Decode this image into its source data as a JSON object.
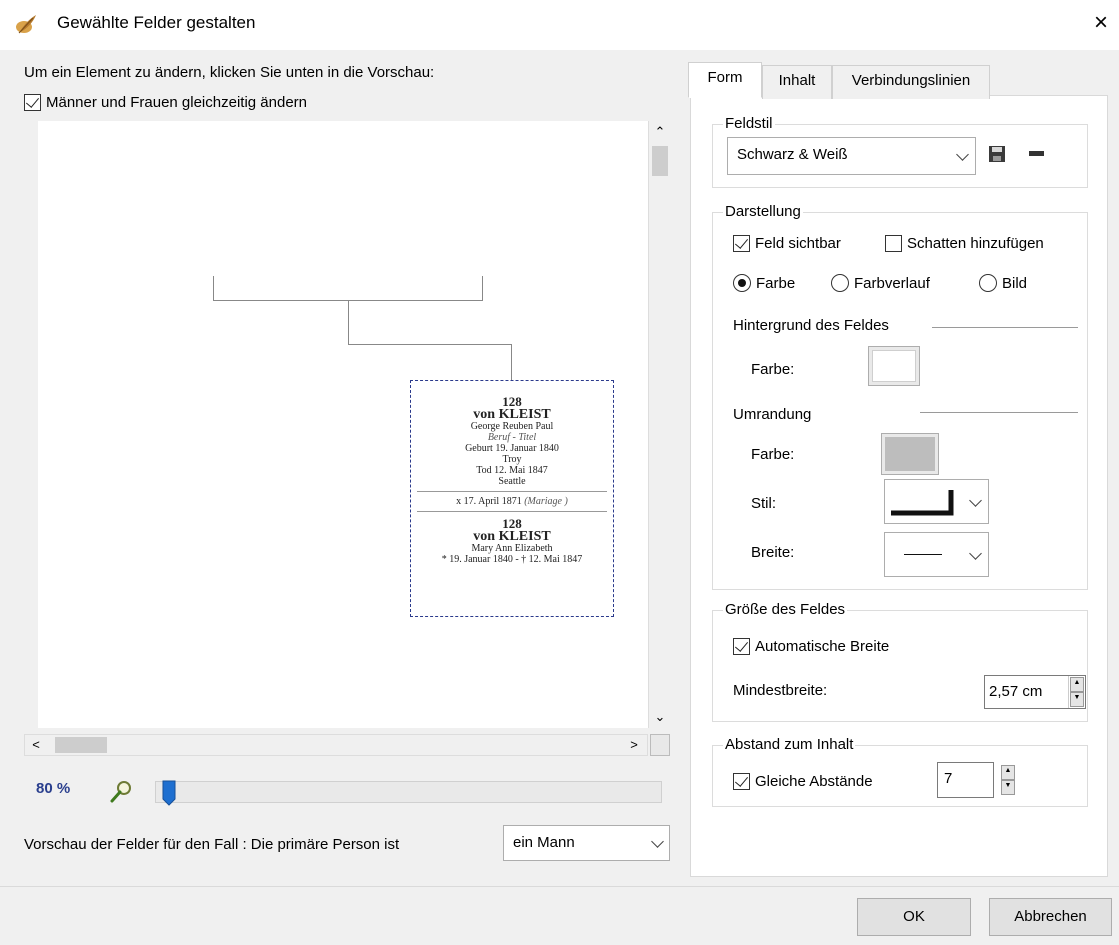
{
  "window": {
    "title": "Gewählte Felder gestalten",
    "close_glyph": "×",
    "icon": "feather-icon"
  },
  "left": {
    "instruction": "Um ein Element zu ändern, klicken Sie unten in die Vorschau:",
    "both_checkbox": {
      "label": "Männer und Frauen gleichzeitig ändern",
      "checked": true
    },
    "preview_card": {
      "husband": {
        "number": "128",
        "surname": "von KLEIST",
        "given_names": "George Reuben Paul",
        "occupation": "Beruf - Titel",
        "birth": "Geburt 19. Januar 1840",
        "birth_place": "Troy",
        "death": "Tod 12. Mai 1847",
        "death_place": "Seattle"
      },
      "marriage": {
        "text": "x 17. April 1871",
        "note": "(Mariage )"
      },
      "wife": {
        "number": "128",
        "surname": "von KLEIST",
        "given_names": "Mary Ann Elizabeth",
        "dates": "* 19. Januar 1840 - † 12. Mai 1847"
      }
    },
    "zoom": {
      "label": "80 %",
      "value_percent": 80
    },
    "preview_for_label": "Vorschau der Felder für den Fall : Die primäre Person ist",
    "person_select": {
      "value": "ein Mann"
    }
  },
  "tabs": [
    {
      "label": "Form",
      "active": true
    },
    {
      "label": "Inhalt",
      "active": false
    },
    {
      "label": "Verbindungslinien",
      "active": false
    }
  ],
  "form": {
    "feldstil": {
      "title": "Feldstil",
      "value": "Schwarz & Weiß"
    },
    "darstellung": {
      "title": "Darstellung",
      "feld_sichtbar": {
        "label": "Feld sichtbar",
        "checked": true
      },
      "schatten": {
        "label": "Schatten hinzufügen",
        "checked": false
      },
      "fill_options": [
        {
          "label": "Farbe",
          "selected": true
        },
        {
          "label": "Farbverlauf",
          "selected": false
        },
        {
          "label": "Bild",
          "selected": false
        }
      ],
      "background_heading": "Hintergrund des Feldes",
      "background_color_label": "Farbe:",
      "background_color": "#ffffff",
      "border_heading": "Umrandung",
      "border_color_label": "Farbe:",
      "border_color": "#bdbdbd",
      "border_style_label": "Stil:",
      "border_width_label": "Breite:"
    },
    "groesse": {
      "title": "Größe des Feldes",
      "auto_width": {
        "label": "Automatische Breite",
        "checked": true
      },
      "min_width_label": "Mindestbreite:",
      "min_width_value": "2,57 cm"
    },
    "abstand": {
      "title": "Abstand zum Inhalt",
      "equal": {
        "label": "Gleiche Abstände",
        "checked": true
      },
      "value": "7"
    }
  },
  "buttons": {
    "ok": "OK",
    "cancel": "Abbrechen"
  },
  "colors": {
    "zoom_label": "#2a3f8e",
    "slider_thumb": "#1e6fd0",
    "card_border": "#2b3a8c"
  }
}
